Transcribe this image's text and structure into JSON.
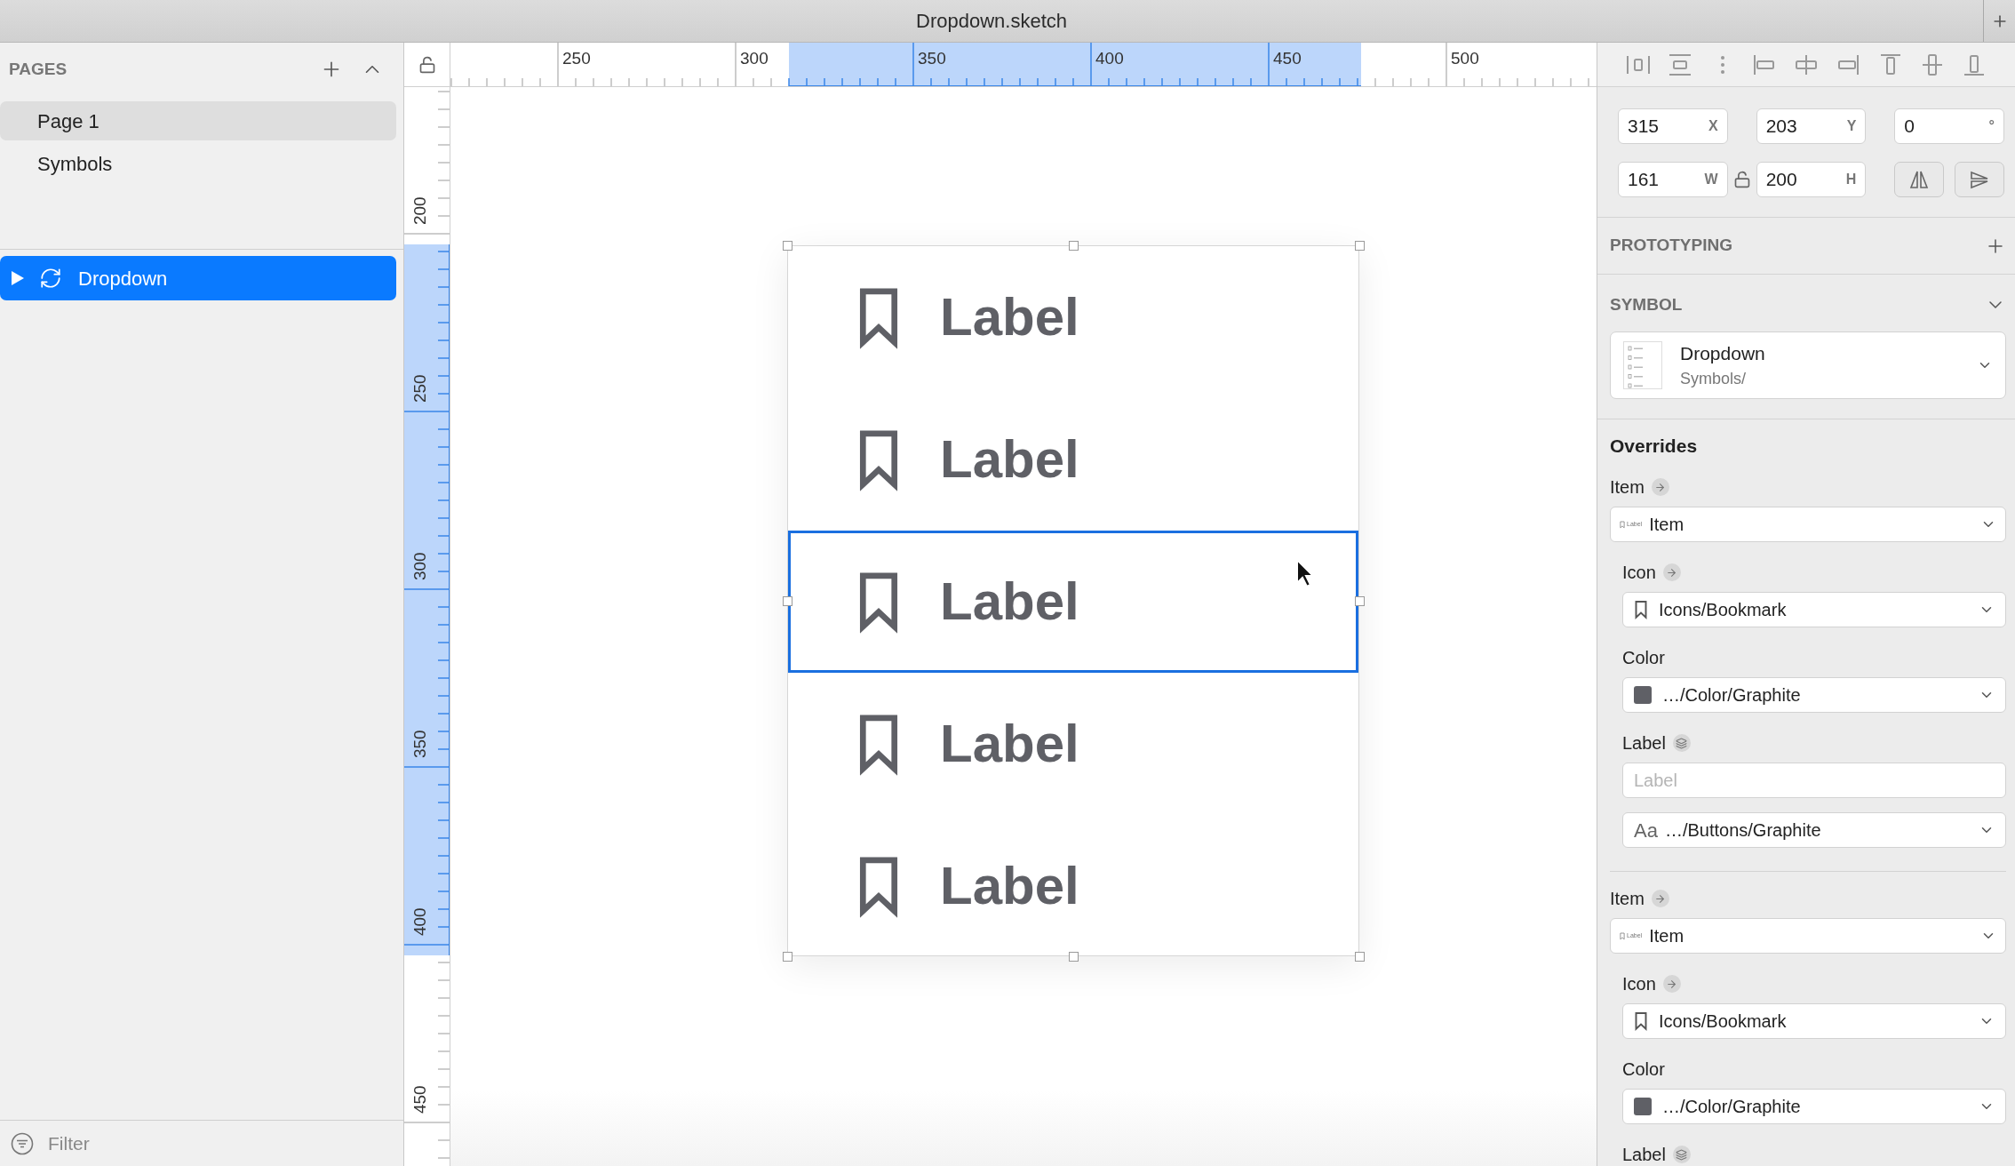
{
  "window": {
    "title": "Dropdown.sketch"
  },
  "pages_panel": {
    "title": "PAGES",
    "pages": [
      {
        "name": "Page 1",
        "selected": true
      },
      {
        "name": "Symbols",
        "selected": false
      }
    ]
  },
  "layers": [
    {
      "name": "Dropdown",
      "selected": true,
      "expanded": false
    }
  ],
  "filter": {
    "placeholder": "Filter"
  },
  "top_ruler": {
    "labels": [
      "250",
      "300",
      "350",
      "400",
      "450",
      "500"
    ]
  },
  "left_ruler": {
    "labels": [
      "200",
      "250",
      "300",
      "350",
      "400",
      "450"
    ]
  },
  "canvas": {
    "rows": [
      {
        "label": "Label",
        "selected": false
      },
      {
        "label": "Label",
        "selected": false
      },
      {
        "label": "Label",
        "selected": true
      },
      {
        "label": "Label",
        "selected": false
      },
      {
        "label": "Label",
        "selected": false
      }
    ]
  },
  "inspector": {
    "position": [
      {
        "value": "315",
        "unit": "X"
      },
      {
        "value": "203",
        "unit": "Y"
      },
      {
        "value": "0",
        "unit": "°"
      }
    ],
    "size": [
      {
        "value": "161",
        "unit": "W"
      },
      {
        "value": "200",
        "unit": "H"
      }
    ],
    "size_locked": false,
    "prototyping": {
      "title": "PROTOTYPING"
    },
    "symbol": {
      "title": "SYMBOL",
      "name": "Dropdown",
      "path": "Symbols/"
    },
    "overrides": {
      "title": "Overrides",
      "groups": [
        {
          "header": "Item",
          "kind": "arrow",
          "value": "Item",
          "thumb_text": "Label",
          "fields": [
            {
              "kind": "heading-arrow",
              "text": "Icon"
            },
            {
              "kind": "icon-select",
              "value": "Icons/Bookmark"
            },
            {
              "kind": "heading",
              "text": "Color"
            },
            {
              "kind": "color-select",
              "value": "…/Color/Graphite"
            },
            {
              "kind": "heading-layers",
              "text": "Label"
            },
            {
              "kind": "input",
              "placeholder": "Label"
            },
            {
              "kind": "style-select",
              "preview": "Aa",
              "value": "…/Buttons/Graphite"
            }
          ]
        },
        {
          "header": "Item",
          "kind": "arrow",
          "value": "Item",
          "thumb_text": "Label",
          "fields": [
            {
              "kind": "heading-arrow",
              "text": "Icon"
            },
            {
              "kind": "icon-select",
              "value": "Icons/Bookmark"
            },
            {
              "kind": "heading",
              "text": "Color"
            },
            {
              "kind": "color-select",
              "value": "…/Color/Graphite"
            },
            {
              "kind": "heading-layers",
              "text": "Label"
            }
          ]
        }
      ]
    }
  }
}
